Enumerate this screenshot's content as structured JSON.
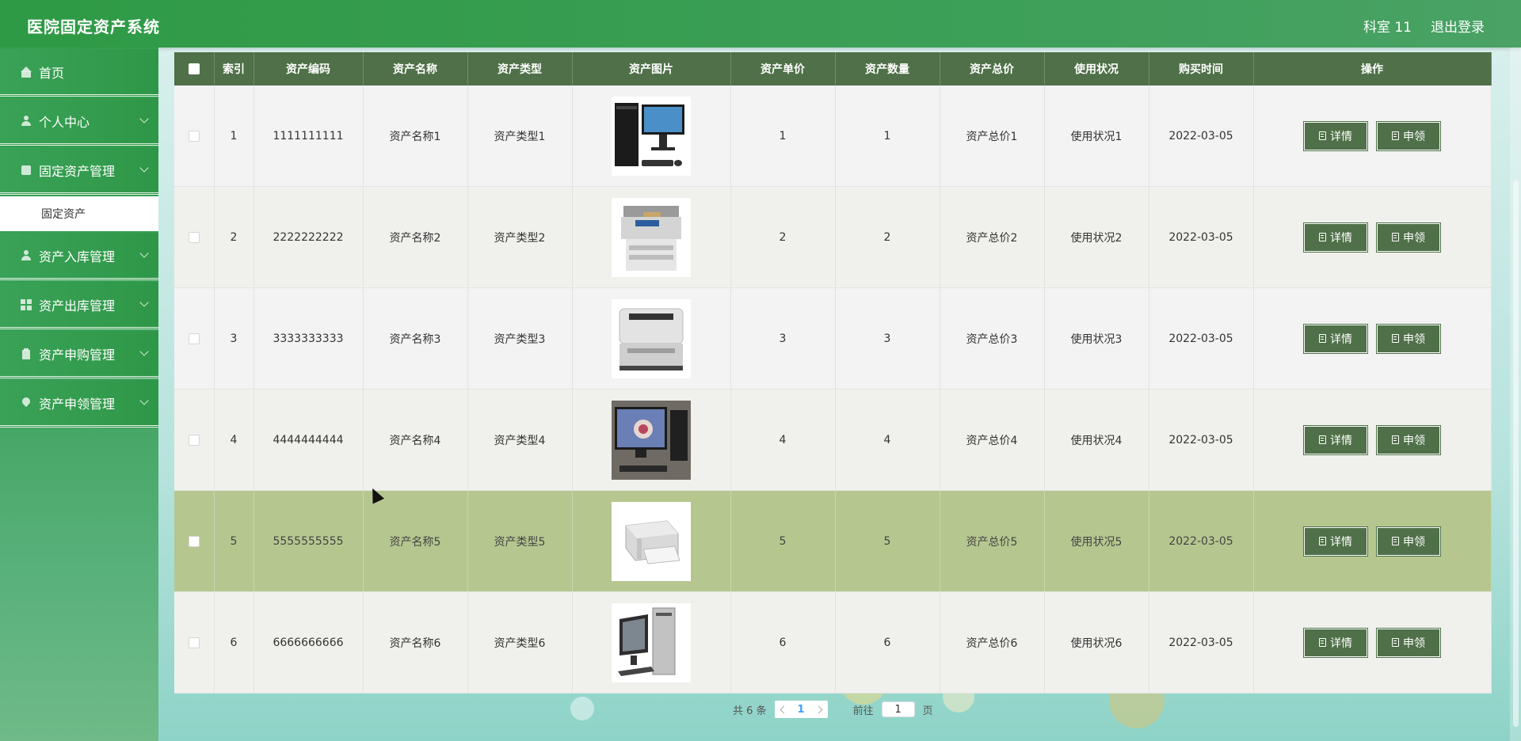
{
  "header": {
    "title": "医院固定资产系统",
    "user": "科室 11",
    "logout": "退出登录"
  },
  "sidebar": {
    "items": [
      {
        "label": "首页",
        "icon": "home-icon"
      },
      {
        "label": "个人中心",
        "icon": "user-icon"
      },
      {
        "label": "固定资产管理",
        "icon": "asset-icon",
        "expanded": true,
        "children": [
          {
            "label": "固定资产"
          }
        ]
      },
      {
        "label": "资产入库管理",
        "icon": "user-icon"
      },
      {
        "label": "资产出库管理",
        "icon": "grid-icon"
      },
      {
        "label": "资产申购管理",
        "icon": "clipboard-icon"
      },
      {
        "label": "资产申领管理",
        "icon": "location-pin-icon"
      }
    ]
  },
  "table": {
    "columns": [
      "索引",
      "资产编码",
      "资产名称",
      "资产类型",
      "资产图片",
      "资产单价",
      "资产数量",
      "资产总价",
      "使用状况",
      "购买时间",
      "操作"
    ],
    "rows": [
      {
        "index": "1",
        "code": "1111111111",
        "name": "资产名称1",
        "type": "资产类型1",
        "image": "desktop-computer",
        "price": "1",
        "qty": "1",
        "total": "资产总价1",
        "status": "使用状况1",
        "date": "2022-03-05"
      },
      {
        "index": "2",
        "code": "2222222222",
        "name": "资产名称2",
        "type": "资产类型2",
        "image": "multifunction-printer",
        "price": "2",
        "qty": "2",
        "total": "资产总价2",
        "status": "使用状况2",
        "date": "2022-03-05"
      },
      {
        "index": "3",
        "code": "3333333333",
        "name": "资产名称3",
        "type": "资产类型3",
        "image": "laser-printer",
        "price": "3",
        "qty": "3",
        "total": "资产总价3",
        "status": "使用状况3",
        "date": "2022-03-05"
      },
      {
        "index": "4",
        "code": "4444444444",
        "name": "资产名称4",
        "type": "资产类型4",
        "image": "monitor-computer",
        "price": "4",
        "qty": "4",
        "total": "资产总价4",
        "status": "使用状况4",
        "date": "2022-03-05"
      },
      {
        "index": "5",
        "code": "5555555555",
        "name": "资产名称5",
        "type": "资产类型5",
        "image": "white-printer",
        "price": "5",
        "qty": "5",
        "total": "资产总价5",
        "status": "使用状况5",
        "date": "2022-03-05",
        "highlighted": true
      },
      {
        "index": "6",
        "code": "6666666666",
        "name": "资产名称6",
        "type": "资产类型6",
        "image": "desktop-computer-2",
        "price": "6",
        "qty": "6",
        "total": "资产总价6",
        "status": "使用状况6",
        "date": "2022-03-05"
      }
    ],
    "actions": {
      "detail": "详情",
      "apply": "申领"
    }
  },
  "pagination": {
    "total": "共 6 条",
    "current": "1",
    "goto_label": "前往",
    "goto_value": "1",
    "page_suffix": "页"
  },
  "colors": {
    "header_green": "#2e9a45",
    "table_header": "#4f7048",
    "row_highlight": "#b5c78f"
  }
}
